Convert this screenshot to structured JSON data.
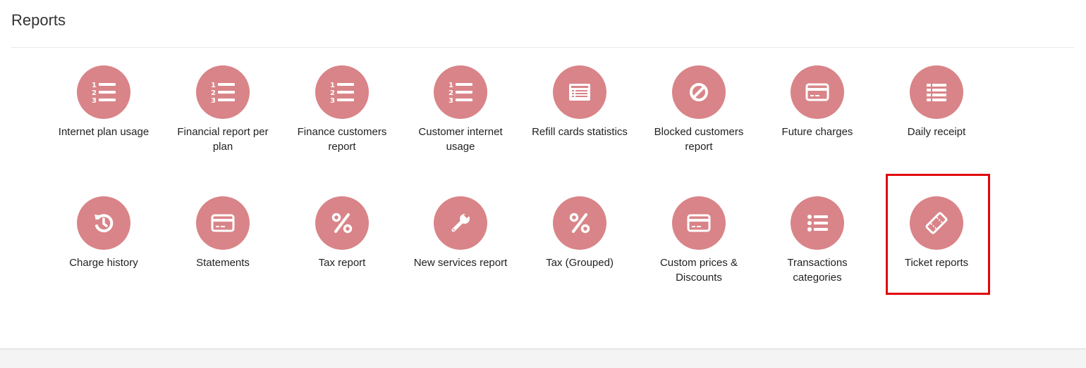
{
  "page": {
    "title": "Reports"
  },
  "colors": {
    "icon_bg": "#d98488",
    "highlight": "#e0060b"
  },
  "reports": [
    {
      "label": "Internet plan usage",
      "icon": "numbered-list-icon"
    },
    {
      "label": "Financial report per plan",
      "icon": "numbered-list-icon"
    },
    {
      "label": "Finance customers report",
      "icon": "numbered-list-icon"
    },
    {
      "label": "Customer internet usage",
      "icon": "numbered-list-icon"
    },
    {
      "label": "Refill cards statistics",
      "icon": "list-alt-icon"
    },
    {
      "label": "Blocked customers report",
      "icon": "ban-icon"
    },
    {
      "label": "Future charges",
      "icon": "credit-card-icon"
    },
    {
      "label": "Daily receipt",
      "icon": "list-icon"
    },
    {
      "label": "Charge history",
      "icon": "history-icon"
    },
    {
      "label": "Statements",
      "icon": "credit-card-icon"
    },
    {
      "label": "Tax report",
      "icon": "percent-icon"
    },
    {
      "label": "New services report",
      "icon": "wrench-icon"
    },
    {
      "label": "Tax (Grouped)",
      "icon": "percent-icon"
    },
    {
      "label": "Custom prices & Discounts",
      "icon": "credit-card-icon"
    },
    {
      "label": "Transactions categories",
      "icon": "list-ul-icon"
    },
    {
      "label": "Ticket reports",
      "icon": "ticket-icon",
      "highlighted": true
    }
  ]
}
